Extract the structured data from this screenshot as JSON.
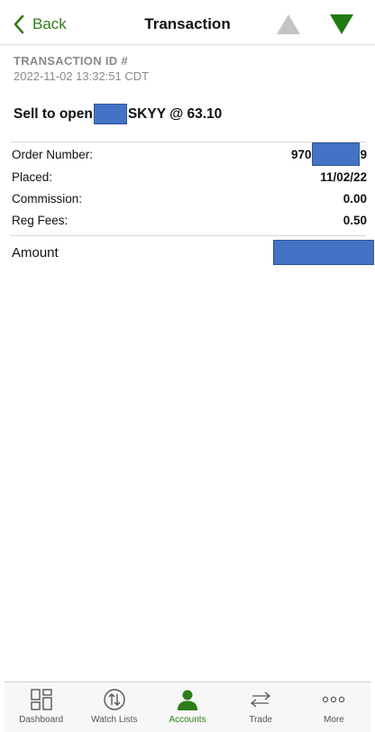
{
  "header": {
    "back_label": "Back",
    "title": "Transaction"
  },
  "transaction": {
    "id_label": "TRANSACTION ID #",
    "timestamp": "2022-11-02 13:32:51 CDT",
    "headline_prefix": "Sell to open",
    "headline_suffix": "SKYY @ 63.10"
  },
  "details": [
    {
      "label": "Order Number:",
      "value_prefix": "970",
      "value_suffix": "9"
    },
    {
      "label": "Placed:",
      "value": "11/02/22"
    },
    {
      "label": "Commission:",
      "value": "0.00"
    },
    {
      "label": "Reg Fees:",
      "value": "0.50"
    }
  ],
  "amount": {
    "label": "Amount"
  },
  "tabs": [
    {
      "label": "Dashboard",
      "icon": "dashboard-icon"
    },
    {
      "label": "Watch Lists",
      "icon": "watch-lists-icon"
    },
    {
      "label": "Accounts",
      "icon": "accounts-icon",
      "active": true
    },
    {
      "label": "Trade",
      "icon": "trade-icon"
    },
    {
      "label": "More",
      "icon": "more-icon"
    }
  ],
  "colors": {
    "accent_green": "#2e7d1a",
    "redaction_blue": "#4472c4",
    "disabled_gray": "#c4c4c4"
  }
}
